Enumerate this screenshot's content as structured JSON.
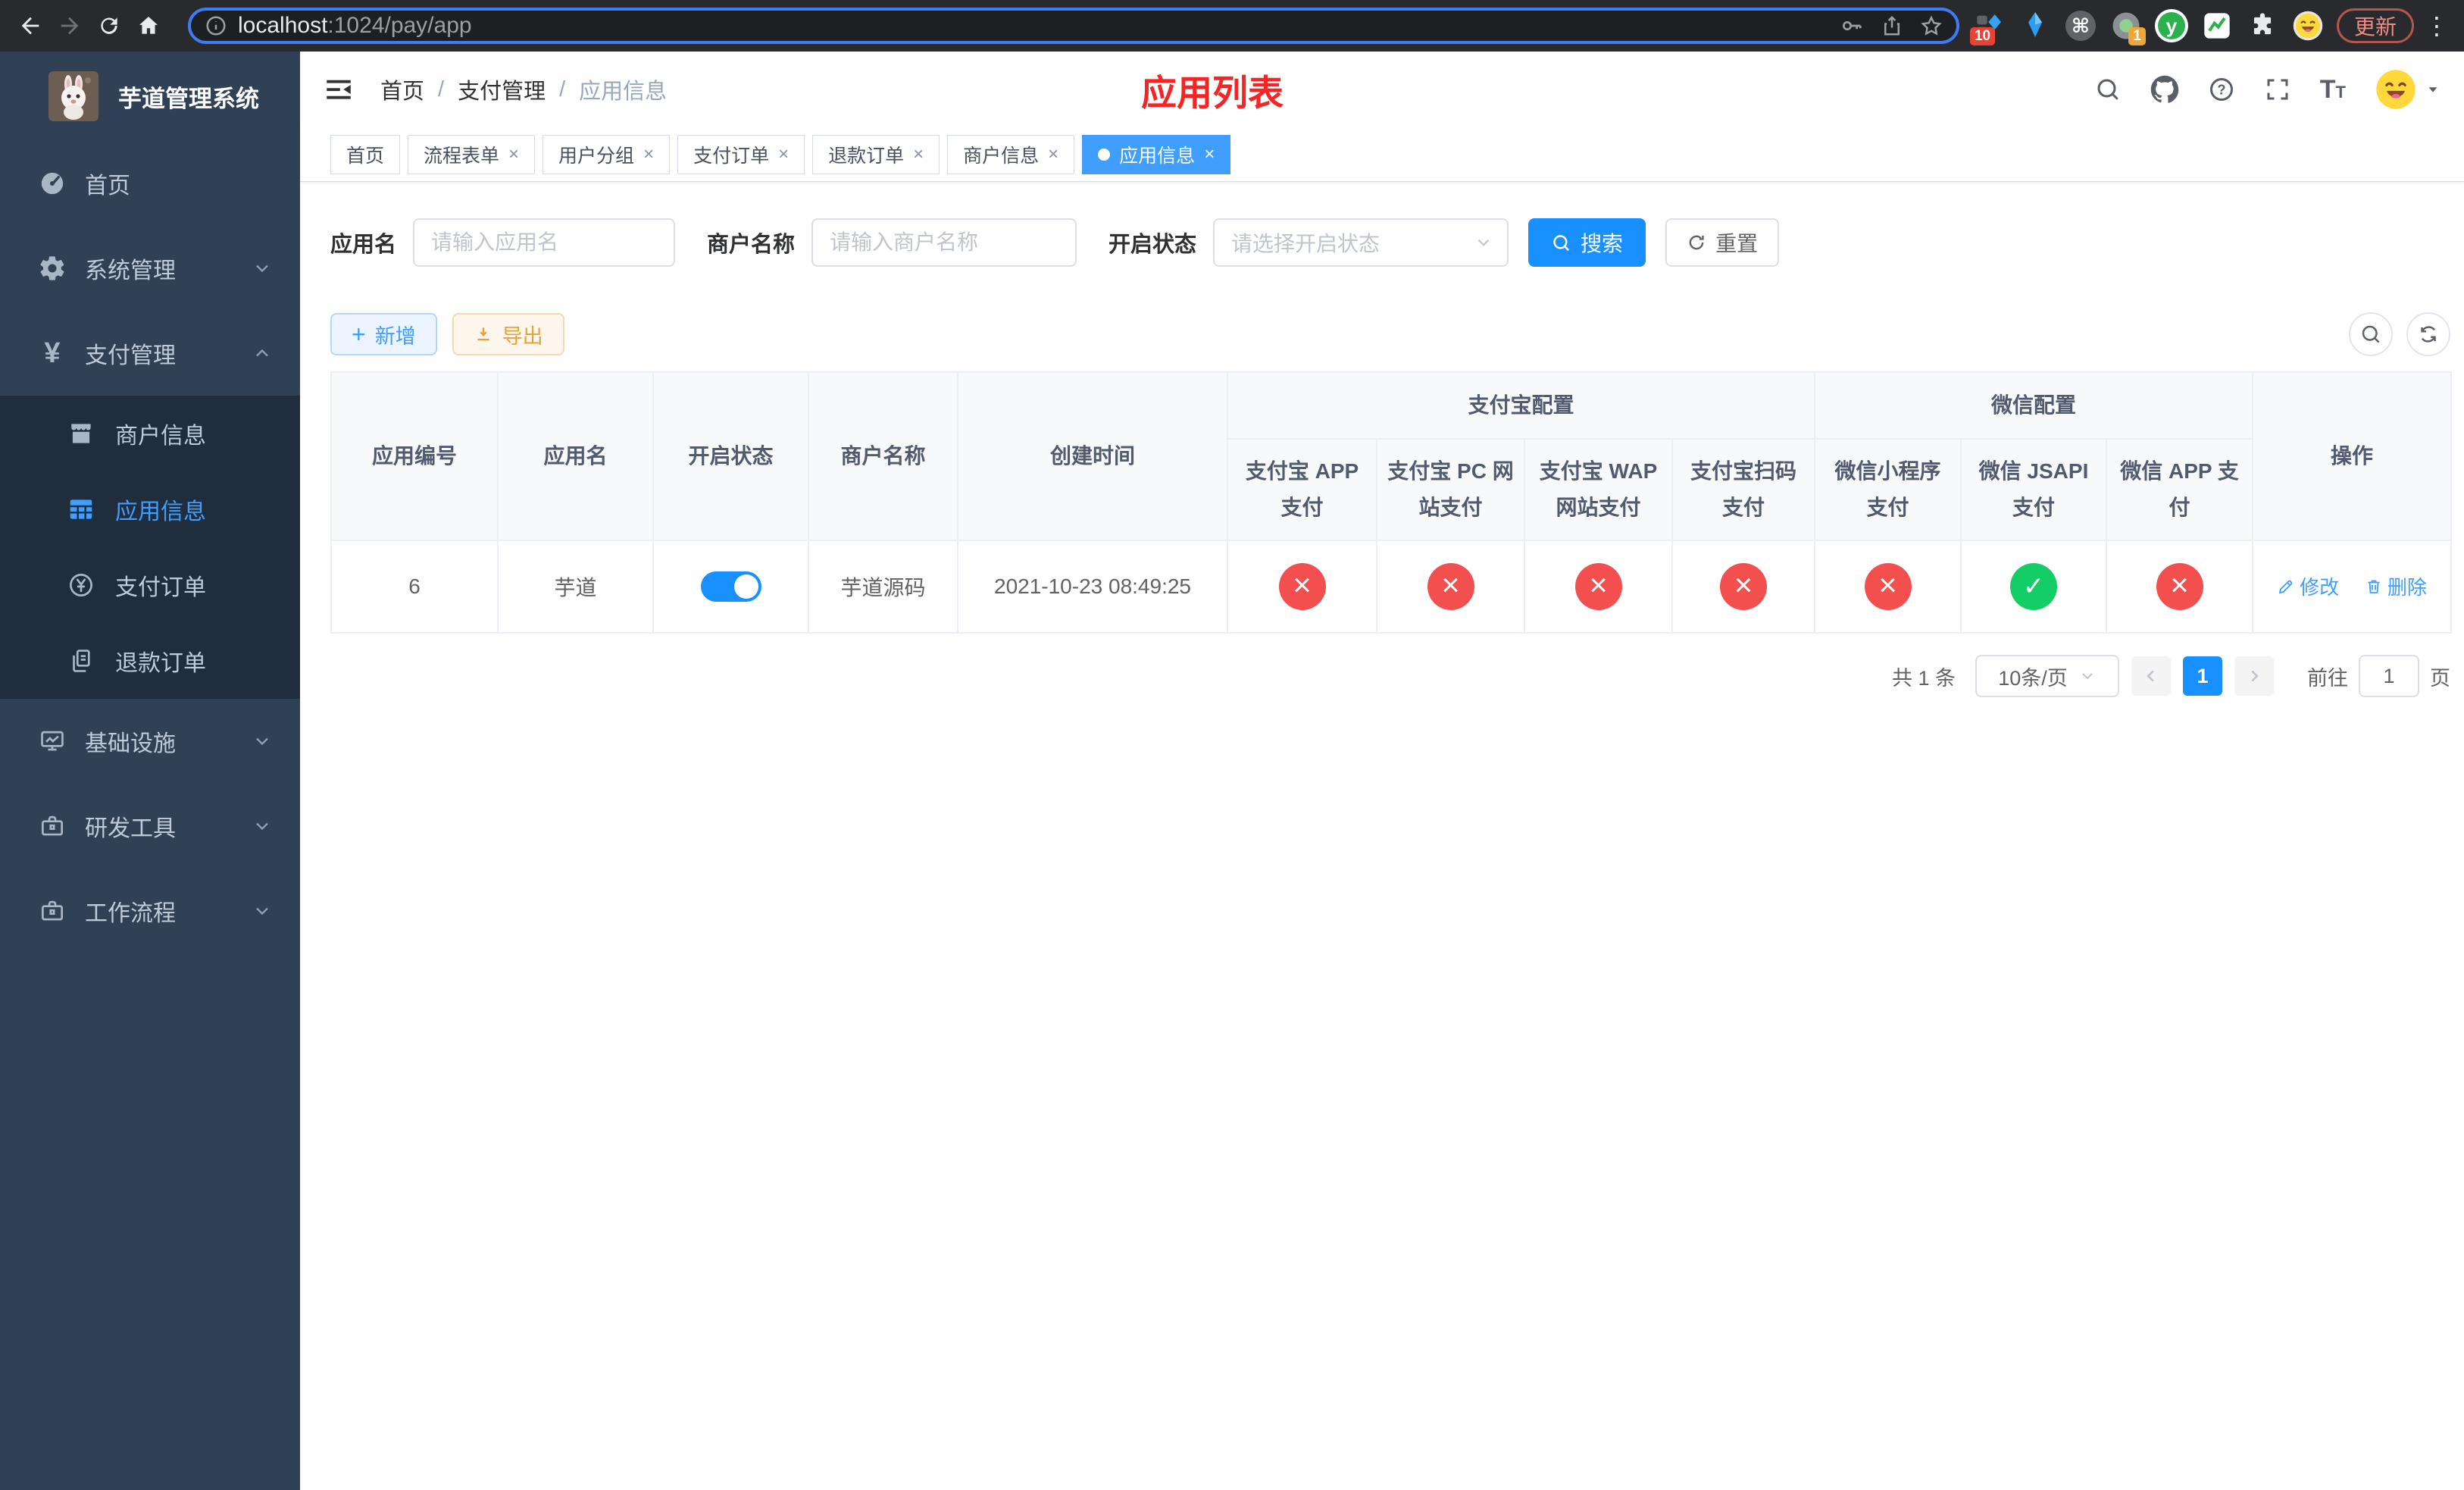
{
  "browser": {
    "url_host": "localhost",
    "url_rest": ":1024/pay/app",
    "update_label": "更新",
    "ext_badge_a": "10",
    "ext_badge_b": "1",
    "ext_cmd_glyph": "⌘",
    "ext_y_glyph": "y",
    "menu_glyph": "⋮"
  },
  "sidebar": {
    "title": "芋道管理系统",
    "items": [
      {
        "label": "首页"
      },
      {
        "label": "系统管理"
      },
      {
        "label": "支付管理"
      },
      {
        "label": "商户信息"
      },
      {
        "label": "应用信息"
      },
      {
        "label": "支付订单"
      },
      {
        "label": "退款订单"
      },
      {
        "label": "基础设施"
      },
      {
        "label": "研发工具"
      },
      {
        "label": "工作流程"
      }
    ],
    "yen_glyph": "¥"
  },
  "navbar": {
    "breadcrumb": [
      "首页",
      "支付管理",
      "应用信息"
    ],
    "separator": "/",
    "page_title": "应用列表",
    "font_icon_big": "T",
    "font_icon_small": "T"
  },
  "tags": {
    "items": [
      {
        "label": "首页"
      },
      {
        "label": "流程表单"
      },
      {
        "label": "用户分组"
      },
      {
        "label": "支付订单"
      },
      {
        "label": "退款订单"
      },
      {
        "label": "商户信息"
      },
      {
        "label": "应用信息"
      }
    ]
  },
  "filters": {
    "app_name_label": "应用名",
    "app_name_placeholder": "请输入应用名",
    "merchant_label": "商户名称",
    "merchant_placeholder": "请输入商户名称",
    "status_label": "开启状态",
    "status_placeholder": "请选择开启状态",
    "search_label": "搜索",
    "reset_label": "重置"
  },
  "toolbar": {
    "add_label": "新增",
    "export_label": "导出",
    "add_plus_glyph": "+"
  },
  "table": {
    "group_alipay": "支付宝配置",
    "group_wechat": "微信配置",
    "col_id": "应用编号",
    "col_name": "应用名",
    "col_status": "开启状态",
    "col_merchant": "商户名称",
    "col_created": "创建时间",
    "col_alipay_app": "支付宝 APP 支付",
    "col_alipay_pc": "支付宝 PC 网站支付",
    "col_alipay_wap": "支付宝 WAP 网站支付",
    "col_alipay_qr": "支付宝扫码支付",
    "col_wx_mini": "微信小程序支付",
    "col_wx_jsapi": "微信 JSAPI 支付",
    "col_wx_app": "微信 APP 支付",
    "col_actions": "操作",
    "row": {
      "id": "6",
      "name": "芋道",
      "enabled": "on",
      "merchant": "芋道源码",
      "created": "2021-10-23 08:49:25",
      "channels": [
        {
          "name": "alipay-app",
          "state": "fail"
        },
        {
          "name": "alipay-pc",
          "state": "fail"
        },
        {
          "name": "alipay-wap",
          "state": "fail"
        },
        {
          "name": "alipay-qr",
          "state": "fail"
        },
        {
          "name": "wechat-mini",
          "state": "fail"
        },
        {
          "name": "wechat-jsapi",
          "state": "pass"
        },
        {
          "name": "wechat-app",
          "state": "fail"
        }
      ],
      "edit_label": "修改",
      "delete_label": "删除"
    }
  },
  "pagination": {
    "total": "共 1 条",
    "page_size": "10条/页",
    "page": "1",
    "goto_label": "前往",
    "goto_value": "1",
    "unit_label": "页"
  },
  "colors": {
    "primary": "#1890ff",
    "link": "#409eff",
    "fail_red": "#f34f4f",
    "pass_green": "#13ce66",
    "sidebar_bg": "#304156",
    "submenu_bg": "#1f2d3d",
    "title_red": "#f52525"
  }
}
